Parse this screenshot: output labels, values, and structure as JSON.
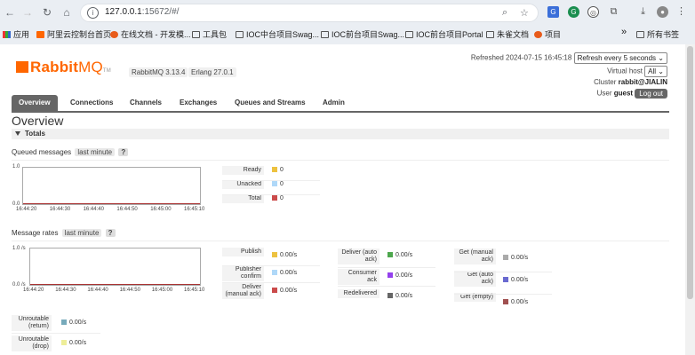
{
  "browser": {
    "url_host": "127.0.0.1",
    "url_path": ":15672/#/",
    "bookmarks": [
      "应用",
      "阿里云控制台首页",
      "在线文档 - 开发模...",
      "工具包",
      "IOC中台项目Swag...",
      "IOC前台项目Swag...",
      "IOC前台项目Portal",
      "朱雀文档",
      "项目",
      "所有书签"
    ],
    "more": "»"
  },
  "header": {
    "brand_rabbit": "Rabbit",
    "brand_mq": "MQ",
    "brand_tm": "TM",
    "rabbitmq_version": "RabbitMQ 3.13.4",
    "erlang_version": "Erlang 27.0.1",
    "refreshed": "Refreshed 2024-07-15 16:45:18",
    "refresh_select": "Refresh every 5 seconds",
    "vhost_label": "Virtual host",
    "vhost_select": "All",
    "cluster_label": "Cluster",
    "cluster_name": "rabbit@JIALIN",
    "user_label": "User",
    "user_name": "guest",
    "logout_label": "Log out"
  },
  "tabs": [
    "Overview",
    "Connections",
    "Channels",
    "Exchanges",
    "Queues and Streams",
    "Admin"
  ],
  "page_title": "Overview",
  "totals_label": "Totals",
  "queued": {
    "label": "Queued messages",
    "range": "last minute",
    "help": "?",
    "y_top": "1.0",
    "y_bottom": "0.0",
    "x_ticks": [
      "16:44:20",
      "16:44:30",
      "16:44:40",
      "16:44:50",
      "16:45:00",
      "16:45:10"
    ],
    "rows": [
      {
        "label": "Ready",
        "value": "0",
        "color": "#edc240"
      },
      {
        "label": "Unacked",
        "value": "0",
        "color": "#afd8f8"
      },
      {
        "label": "Total",
        "value": "0",
        "color": "#cb4b4b"
      }
    ]
  },
  "rates": {
    "label": "Message rates",
    "range": "last minute",
    "help": "?",
    "y_top": "1.0 /s",
    "y_bottom": "0.0 /s",
    "x_ticks": [
      "16:44:20",
      "16:44:30",
      "16:44:40",
      "16:44:50",
      "16:45:00",
      "16:45:10"
    ],
    "col1": [
      {
        "label": "Publish",
        "value": "0.00/s",
        "color": "#edc240"
      },
      {
        "label": "Publisher confirm",
        "value": "0.00/s",
        "color": "#afd8f8"
      },
      {
        "label": "Deliver (manual ack)",
        "value": "0.00/s",
        "color": "#cb4b4b"
      }
    ],
    "col2": [
      {
        "label": "Deliver (auto ack)",
        "value": "0.00/s",
        "color": "#4da74d"
      },
      {
        "label": "Consumer ack",
        "value": "0.00/s",
        "color": "#9440ed"
      },
      {
        "label": "Redelivered",
        "value": "0.00/s",
        "color": "#666666"
      }
    ],
    "col3": [
      {
        "label": "Get (manual ack)",
        "value": "0.00/s",
        "color": "#aaaaaa"
      },
      {
        "label": "Get (auto ack)",
        "value": "0.00/s",
        "color": "#6a6ad0"
      },
      {
        "label": "Get (empty)",
        "value": "0.00/s",
        "color": "#a05050"
      }
    ],
    "col0": [
      {
        "label": "Unroutable (return)",
        "value": "0.00/s",
        "color": "#77aabb"
      },
      {
        "label": "Unroutable (drop)",
        "value": "0.00/s",
        "color": "#eeee99"
      }
    ]
  }
}
